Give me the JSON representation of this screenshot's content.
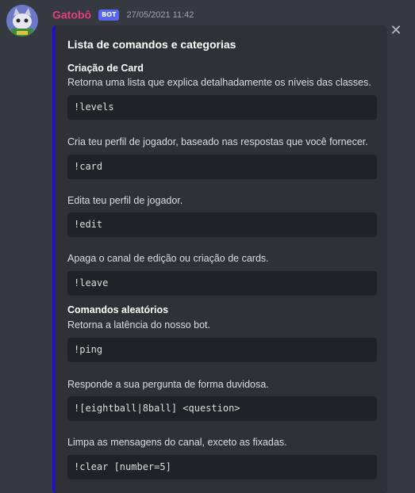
{
  "message": {
    "username": "Gatobô",
    "bot_tag": "BOT",
    "timestamp": "27/05/2021 11:42",
    "close_symbol": "✕",
    "avatar_icon": "cat-avatar",
    "accent_color": "#1f11c6",
    "username_color": "#e0417a"
  },
  "embed": {
    "title": "Lista de comandos e categorias",
    "sections": [
      {
        "name": "Criação de Card",
        "commands": [
          {
            "description": "Retorna uma lista que explica detalhadamente os níveis das classes.",
            "code": "!levels"
          },
          {
            "description": "Cria teu perfil de jogador, baseado nas respostas que você fornecer.",
            "code": "!card"
          },
          {
            "description": "Edita teu perfil de jogador.",
            "code": "!edit"
          },
          {
            "description": "Apaga o canal de edição ou criação de cards.",
            "code": "!leave"
          }
        ]
      },
      {
        "name": "Comandos aleatórios",
        "commands": [
          {
            "description": "Retorna a latência do nosso bot.",
            "code": "!ping"
          },
          {
            "description": "Responde a sua pergunta de forma duvidosa.",
            "code": "![eightball|8ball] <question>"
          },
          {
            "description": "Limpa as mensagens do canal, exceto as fixadas.",
            "code": "!clear [number=5]"
          }
        ]
      }
    ]
  }
}
